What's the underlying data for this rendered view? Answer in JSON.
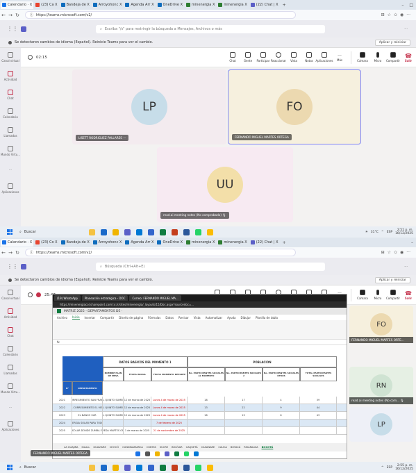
{
  "top": {
    "tabs": [
      {
        "label": "Calendario · X",
        "color": "#1a73e8"
      },
      {
        "label": "(23) Ca X",
        "color": "#e8442f"
      },
      {
        "label": "Bandeja de X",
        "color": "#0f6cbd"
      },
      {
        "label": "Arroyohonc X",
        "color": "#0f6cbd"
      },
      {
        "label": "Agenda Arr X",
        "color": "#0f6cbd"
      },
      {
        "label": "OneDrive X",
        "color": "#0f6cbd"
      },
      {
        "label": "minenergia X",
        "color": "#2e7d32"
      },
      {
        "label": "minenergia X",
        "color": "#2e7d32"
      },
      {
        "label": "(22) Chat | X",
        "color": "#5b5fc7"
      }
    ],
    "url": "https://teams.microsoft.com/v2/",
    "search_placeholder": "Escriba \"/s\" para restringir la búsqueda a Mensajes, Archivos o más",
    "banner": "Se detectaron cambios de idioma (Español). Reinicie Teams para ver el cambio.",
    "banner_button": "Aplicar y reiniciar",
    "timer": "02:15",
    "controls": [
      "Chat",
      "Gente",
      "Participar",
      "Reaccionar",
      "Vista",
      "Notas",
      "Aplicaciones",
      "Más",
      "Cámara",
      "Micro",
      "Compartir",
      "Salir"
    ],
    "participants_count": "3",
    "tiles": [
      {
        "initials": "LP",
        "name": "LISETT RODRIGUEZ PALLARES ···"
      },
      {
        "initials": "FO",
        "name": "FERNANDO MIGUEL MARTES ORTEGA"
      },
      {
        "initials": "UU",
        "name": "read.ai meeting notes (No comprobado) 🎙"
      }
    ],
    "taskbar_search": "Buscar",
    "weather": "31°C",
    "lang": "ESP",
    "clock_time": "2:51 p. m.",
    "clock_date": "16/12/2025"
  },
  "bottom": {
    "tabs": [
      {
        "label": "Calendario · X",
        "color": "#1a73e8"
      },
      {
        "label": "(23) Co X",
        "color": "#e8442f"
      },
      {
        "label": "Bandeja de X",
        "color": "#0f6cbd"
      },
      {
        "label": "Arroyohonc X",
        "color": "#0f6cbd"
      },
      {
        "label": "Agenda Arr X",
        "color": "#0f6cbd"
      },
      {
        "label": "OneDrive X",
        "color": "#0f6cbd"
      },
      {
        "label": "minenergia X",
        "color": "#2e7d32"
      },
      {
        "label": "minenergia X",
        "color": "#2e7d32"
      },
      {
        "label": "(22) Chat | X",
        "color": "#5b5fc7"
      }
    ],
    "url": "https://teams.microsoft.com/v2/",
    "search_placeholder": "Búsqueda (Ctrl+Alt+E)",
    "banner": "Se detectaron cambios de idioma (Español). Reinicie Teams para ver el cambio.",
    "banner_button": "Aplicar y reiniciar",
    "timer": "25:47",
    "controls": [
      "Controlar",
      "Chat",
      "Gente",
      "Participar",
      "Reaccionar",
      "Vista",
      "Notas",
      "Aplicaciones",
      "Más",
      "Cámara",
      "Micro",
      "Compartir",
      "Salir"
    ],
    "sidetiles": [
      {
        "initials": "FO",
        "name": "FERNANDO MIGUEL MARTES ORTE..."
      },
      {
        "initials": "RN",
        "name": "read.ai meeting notes (No com... 🎙"
      },
      {
        "initials": "LP",
        "name": ""
      }
    ],
    "share_name": "FERNANDO MIGUEL MARTES ORTEGA",
    "taskbar_search": "Buscar",
    "lang": "ESP",
    "clock_time": "2:55 p. m.",
    "clock_date": "16/12/2025"
  },
  "rail": [
    "Canal virtual",
    "Actividad",
    "Chat",
    "Calendario",
    "Llamadas",
    "Mundo Virtu...",
    "···",
    "Aplicaciones"
  ],
  "excel": {
    "tabs": [
      "(19) WhatsApp",
      "Planeación estratégica - DOC",
      "Correo: FERNANDO MIGUEL MA..."
    ],
    "url": "https://minenergiacol.sharepoint.com/:x:/r/sites/minenergia/_layouts/15/Doc.aspx?sourcedoc=...",
    "title": "MATRIZ 2025 - DEPARTAMENTOS DE ·",
    "menu": [
      "Archivo",
      "Inicio",
      "Insertar",
      "Compartir",
      "Diseño de página",
      "Fórmulas",
      "Datos",
      "Revisar",
      "Vista",
      "Automatizar",
      "Ayuda",
      "Dibujar",
      "Planilla de tabla"
    ],
    "header_left": "DATOS BASICOS DEL MOMENTO 1",
    "header_right": "POBLACION",
    "cols": [
      "N°",
      "DEPARTAMENTO",
      "NOMBRE PLAN DE MESA",
      "FECHA INICIAL",
      "FECHA MOMENTO REPORTE",
      "No. PARTICIPANTES SOCIALES AL MOMENTO",
      "No. PARTICIPANTES SOCIALES 2",
      "No. PARTICIPANTES SOCIALES OTROS",
      "TOTAL PARTICIPANTES SOCIALES"
    ],
    "rows": [
      [
        "2021",
        "DEL CORREGIMIENTO SAN FRANCISCO",
        "DEL QUINTO SUMERO",
        "12 de marzo de 2025",
        "Lunes 4 de marzo de 2025",
        "18",
        "17",
        "4",
        "39"
      ],
      [
        "2022",
        "DEL CORREGIMIENTO EL MEDIO",
        "DEL QUINTO SUMERO",
        "12 de marzo de 2025",
        "Lunes 4 de marzo de 2025",
        "13",
        "22",
        "9",
        "44"
      ],
      [
        "2023",
        "EL BANCO SUR",
        "DEL QUINTO SUMERO",
        "12 de marzo de 2025",
        "Lunes 4 de marzo de 2025",
        "18",
        "19",
        "6",
        "43"
      ],
      [
        "2024",
        "ENERGIA SOLAR PARA TODOS",
        "",
        "",
        "7 de febrero de 2025",
        "",
        "",
        "",
        ""
      ],
      [
        "2025",
        "VEREDA SOLAR DONDE ZUMBA EL CAMPO",
        "VEREDA MARTES ORTE",
        "1 de marzo de 2025",
        "21 de noviembre de 2025",
        "",
        "",
        "",
        ""
      ]
    ],
    "sheets": [
      "LA GUAJIRA",
      "ISLALL",
      "GUAVIARE",
      "CHOCÓ",
      "CUNDINAMARCA",
      "CUESTA",
      "SUCRE",
      "BOLÍVAR",
      "CAQUETÁ",
      "CASANARE",
      "CAUCA",
      "BOYACÁ",
      "RISARALDA",
      "BOGOTÁ"
    ],
    "active_sheet": "BOGOTÁ"
  },
  "colors": {
    "accent": "#5b5fc7",
    "leave": "#c4314b",
    "tile_lp": "#f3ebef",
    "tile_fo": "#f6f0de",
    "tile_uu": "#f7eaf2",
    "avatar_lp": "#c7dde9",
    "avatar_fo": "#ecd9b0",
    "avatar_uu": "#f3dfa9",
    "excel_green": "#107c41"
  }
}
